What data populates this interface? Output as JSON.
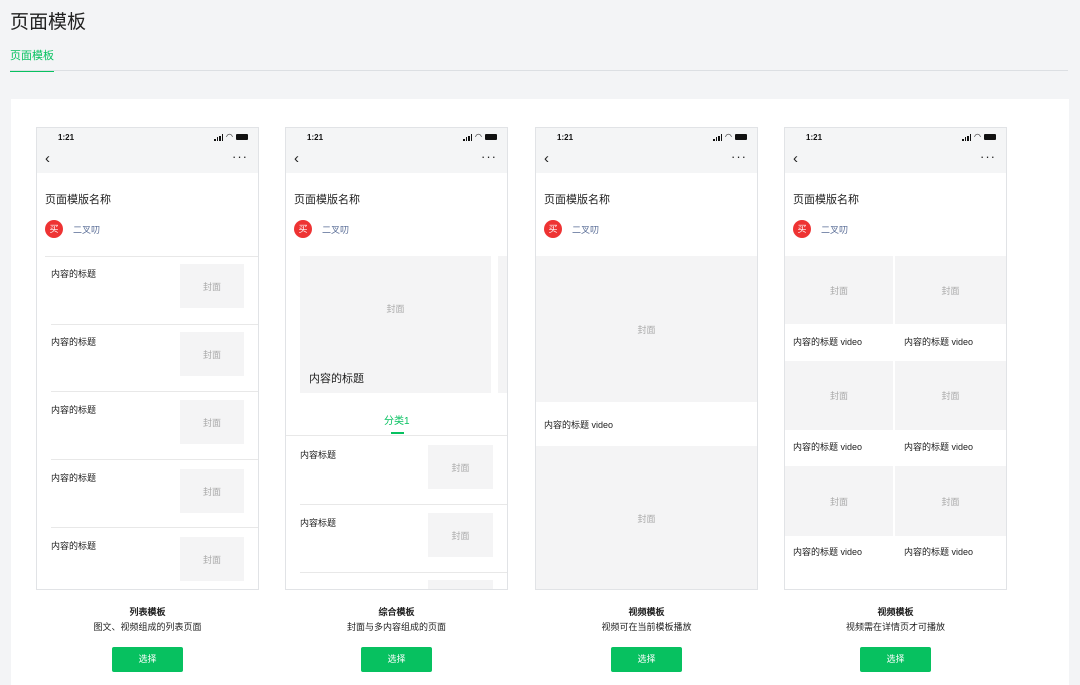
{
  "page": {
    "title": "页面模板",
    "tab": "页面模板"
  },
  "colors": {
    "accent": "#07c160",
    "link": "#576b95",
    "avatar": "#ee3333"
  },
  "phone_common": {
    "time": "1:21",
    "back_icon": "‹",
    "more_icon": "···",
    "page_title": "页面模版名称",
    "avatar_text": "买",
    "author": "二叉叨",
    "cover_label": "封面"
  },
  "templates": [
    {
      "name": "列表模板",
      "desc": "图文、视频组成的列表页面",
      "button": "选择",
      "items": [
        "内容的标题",
        "内容的标题",
        "内容的标题",
        "内容的标题",
        "内容的标题"
      ]
    },
    {
      "name": "综合模板",
      "desc": "封面与多内容组成的页面",
      "button": "选择",
      "featured_title": "内容的标题",
      "category_tab": "分类1",
      "items": [
        "内容标题",
        "内容标题"
      ]
    },
    {
      "name": "视频模板",
      "desc": "视频可在当前模板播放",
      "button": "选择",
      "video_title": "内容的标题 video"
    },
    {
      "name": "视频模板",
      "desc": "视频需在详情页才可播放",
      "button": "选择",
      "grid_items": [
        "内容的标题 video",
        "内容的标题 video",
        "内容的标题 video",
        "内容的标题 video",
        "内容的标题 video",
        "内容的标题 video"
      ]
    }
  ]
}
